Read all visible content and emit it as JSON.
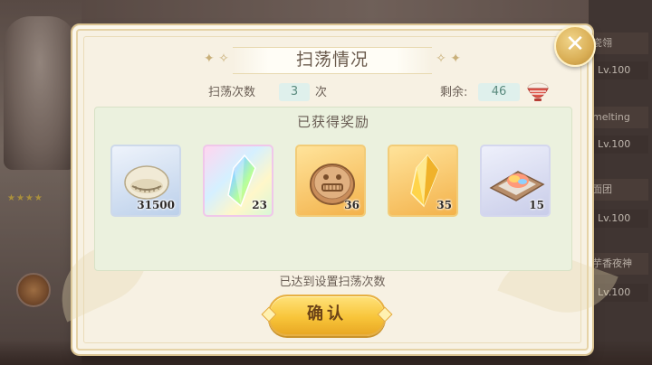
{
  "dialog": {
    "title": "扫荡情况",
    "sweep_count_label": "扫荡次数",
    "sweep_count_value": "3",
    "sweep_count_unit": "次",
    "remaining_label": "剩余:",
    "remaining_value": "46",
    "rewards_title": "已获得奖励",
    "status_text": "已达到设置扫荡次数",
    "confirm_label": "确认",
    "close_icon": "close-icon"
  },
  "rewards": [
    {
      "icon": "shell-icon",
      "quantity": "31500"
    },
    {
      "icon": "rainbow-crystal-icon",
      "quantity": "23"
    },
    {
      "icon": "bronze-coin-icon",
      "quantity": "36"
    },
    {
      "icon": "gold-crystal-icon",
      "quantity": "35"
    },
    {
      "icon": "shaved-ice-icon",
      "quantity": "15"
    }
  ],
  "background": {
    "right_panel": [
      {
        "name": "瓷翎",
        "level": "Lv.100"
      },
      {
        "name": "melting",
        "level": "Lv.100"
      },
      {
        "name": "面团",
        "level": "Lv.100"
      },
      {
        "name": "芋香夜神",
        "level": "Lv.100"
      }
    ]
  },
  "colors": {
    "dialog_bg": "#f7f1e3",
    "panel_bg": "#ebf1de",
    "button_gold": "#f8c53a",
    "text_brown": "#6a5e55",
    "value_teal": "#5a8a7e"
  }
}
